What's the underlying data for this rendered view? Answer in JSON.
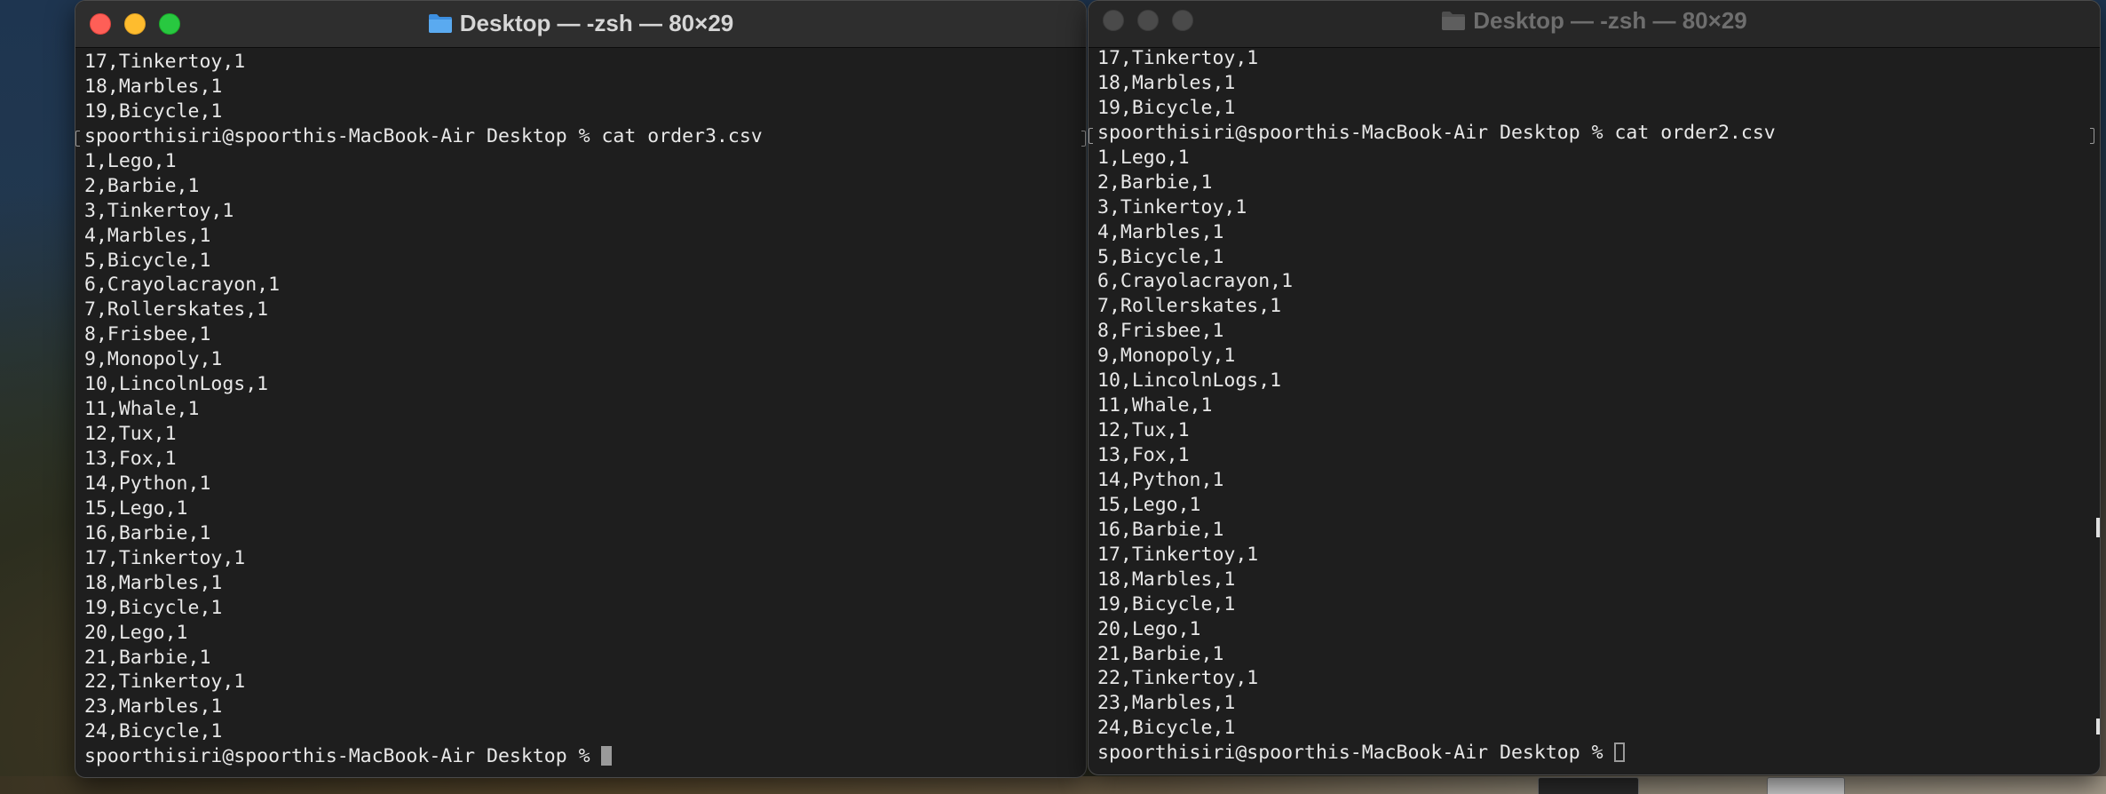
{
  "colors": {
    "terminal_bg": "#1e1e1e",
    "terminal_text": "#e8e8e8",
    "titlebar_active": "#2e2e2e",
    "titlebar_inactive": "#272727",
    "close": "#fe5f57",
    "minimize": "#febc2e",
    "zoom": "#28c840"
  },
  "windows": {
    "left": {
      "title": "Desktop — -zsh — 80×29",
      "title_icon": "folder-icon",
      "active": true,
      "lines": [
        "17,Tinkertoy,1",
        "18,Marbles,1",
        "19,Bicycle,1",
        "spoorthisiri@spoorthis-MacBook-Air Desktop % cat order3.csv",
        "1,Lego,1",
        "2,Barbie,1",
        "3,Tinkertoy,1",
        "4,Marbles,1",
        "5,Bicycle,1",
        "6,Crayolacrayon,1",
        "7,Rollerskates,1",
        "8,Frisbee,1",
        "9,Monopoly,1",
        "10,LincolnLogs,1",
        "11,Whale,1",
        "12,Tux,1",
        "13,Fox,1",
        "14,Python,1",
        "15,Lego,1",
        "16,Barbie,1",
        "17,Tinkertoy,1",
        "18,Marbles,1",
        "19,Bicycle,1",
        "20,Lego,1",
        "21,Barbie,1",
        "22,Tinkertoy,1",
        "23,Marbles,1",
        "24,Bicycle,1"
      ],
      "prompt": "spoorthisiri@spoorthis-MacBook-Air Desktop % ",
      "cursor": "solid-block"
    },
    "right": {
      "title": "Desktop — -zsh — 80×29",
      "title_icon": "folder-icon",
      "active": false,
      "lines": [
        "17,Tinkertoy,1",
        "18,Marbles,1",
        "19,Bicycle,1",
        "spoorthisiri@spoorthis-MacBook-Air Desktop % cat order2.csv",
        "1,Lego,1",
        "2,Barbie,1",
        "3,Tinkertoy,1",
        "4,Marbles,1",
        "5,Bicycle,1",
        "6,Crayolacrayon,1",
        "7,Rollerskates,1",
        "8,Frisbee,1",
        "9,Monopoly,1",
        "10,LincolnLogs,1",
        "11,Whale,1",
        "12,Tux,1",
        "13,Fox,1",
        "14,Python,1",
        "15,Lego,1",
        "16,Barbie,1",
        "17,Tinkertoy,1",
        "18,Marbles,1",
        "19,Bicycle,1",
        "20,Lego,1",
        "21,Barbie,1",
        "22,Tinkertoy,1",
        "23,Marbles,1",
        "24,Bicycle,1"
      ],
      "prompt": "spoorthisiri@spoorthis-MacBook-Air Desktop % ",
      "cursor": "hollow-block"
    }
  }
}
